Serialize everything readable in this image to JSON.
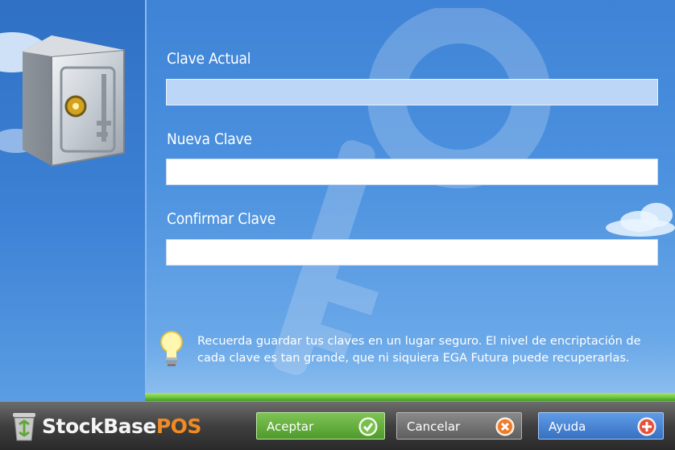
{
  "form": {
    "current_label": "Clave Actual",
    "current_value": "",
    "new_label": "Nueva Clave",
    "new_value": "",
    "confirm_label": "Confirmar Clave",
    "confirm_value": ""
  },
  "tip": {
    "icon": "lightbulb-icon",
    "text": "Recuerda guardar tus claves en un lugar seguro. El nivel de encriptación de cada clave es tan grande, que ni siquiera EGA Futura puede recuperarlas."
  },
  "footer": {
    "logo_part1": "StockBase",
    "logo_part2": "POS",
    "accept_label": "Aceptar",
    "cancel_label": "Cancelar",
    "help_label": "Ayuda"
  },
  "colors": {
    "background": "#4d92df",
    "accept": "#5ea836",
    "cancel": "#6e6e6e",
    "help": "#4a86d6",
    "logo_accent": "#f08a22"
  }
}
